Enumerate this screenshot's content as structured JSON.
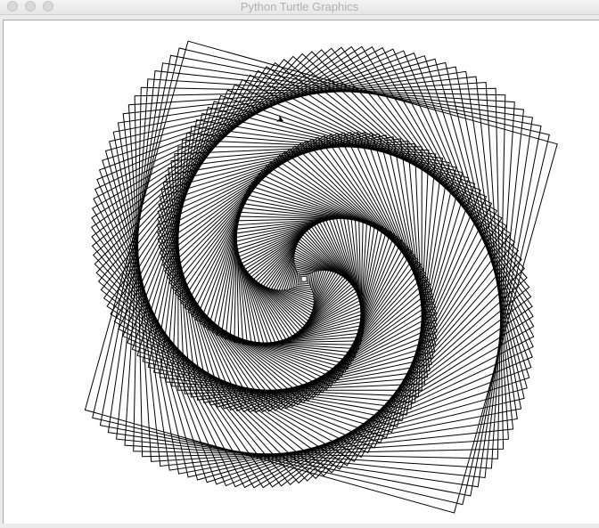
{
  "window": {
    "title": "Python Turtle Graphics",
    "controls": [
      "close",
      "minimize",
      "zoom"
    ]
  },
  "canvas": {
    "background": "#ffffff",
    "stroke_color": "#000000",
    "drawing": "nested rotating squares spiral"
  }
}
